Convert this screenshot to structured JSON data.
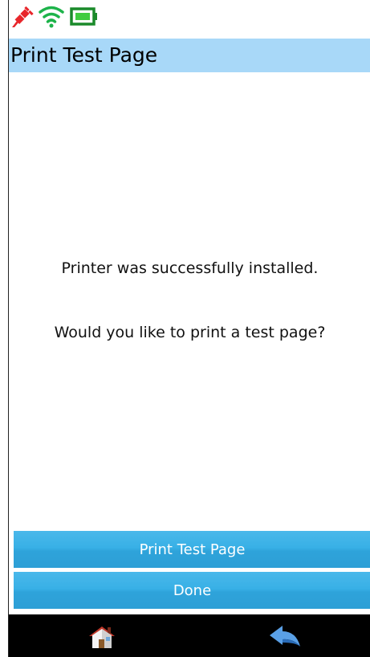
{
  "status": {
    "icons": [
      "plug-disconnected-icon",
      "wifi-icon",
      "battery-icon"
    ],
    "colors": {
      "plug": "#e8262b",
      "wifi": "#1db34a",
      "battery": "#1a8a2a"
    }
  },
  "header": {
    "title": "Print Test Page",
    "background": "#a8d8f8"
  },
  "content": {
    "message_installed": "Printer was successfully installed.",
    "message_question": "Would you like to print a test page?"
  },
  "actions": {
    "print_label": "Print Test Page",
    "done_label": "Done",
    "button_color": "#38b0e6"
  },
  "nav": {
    "icons": [
      "home-icon",
      "back-arrow-icon"
    ]
  }
}
